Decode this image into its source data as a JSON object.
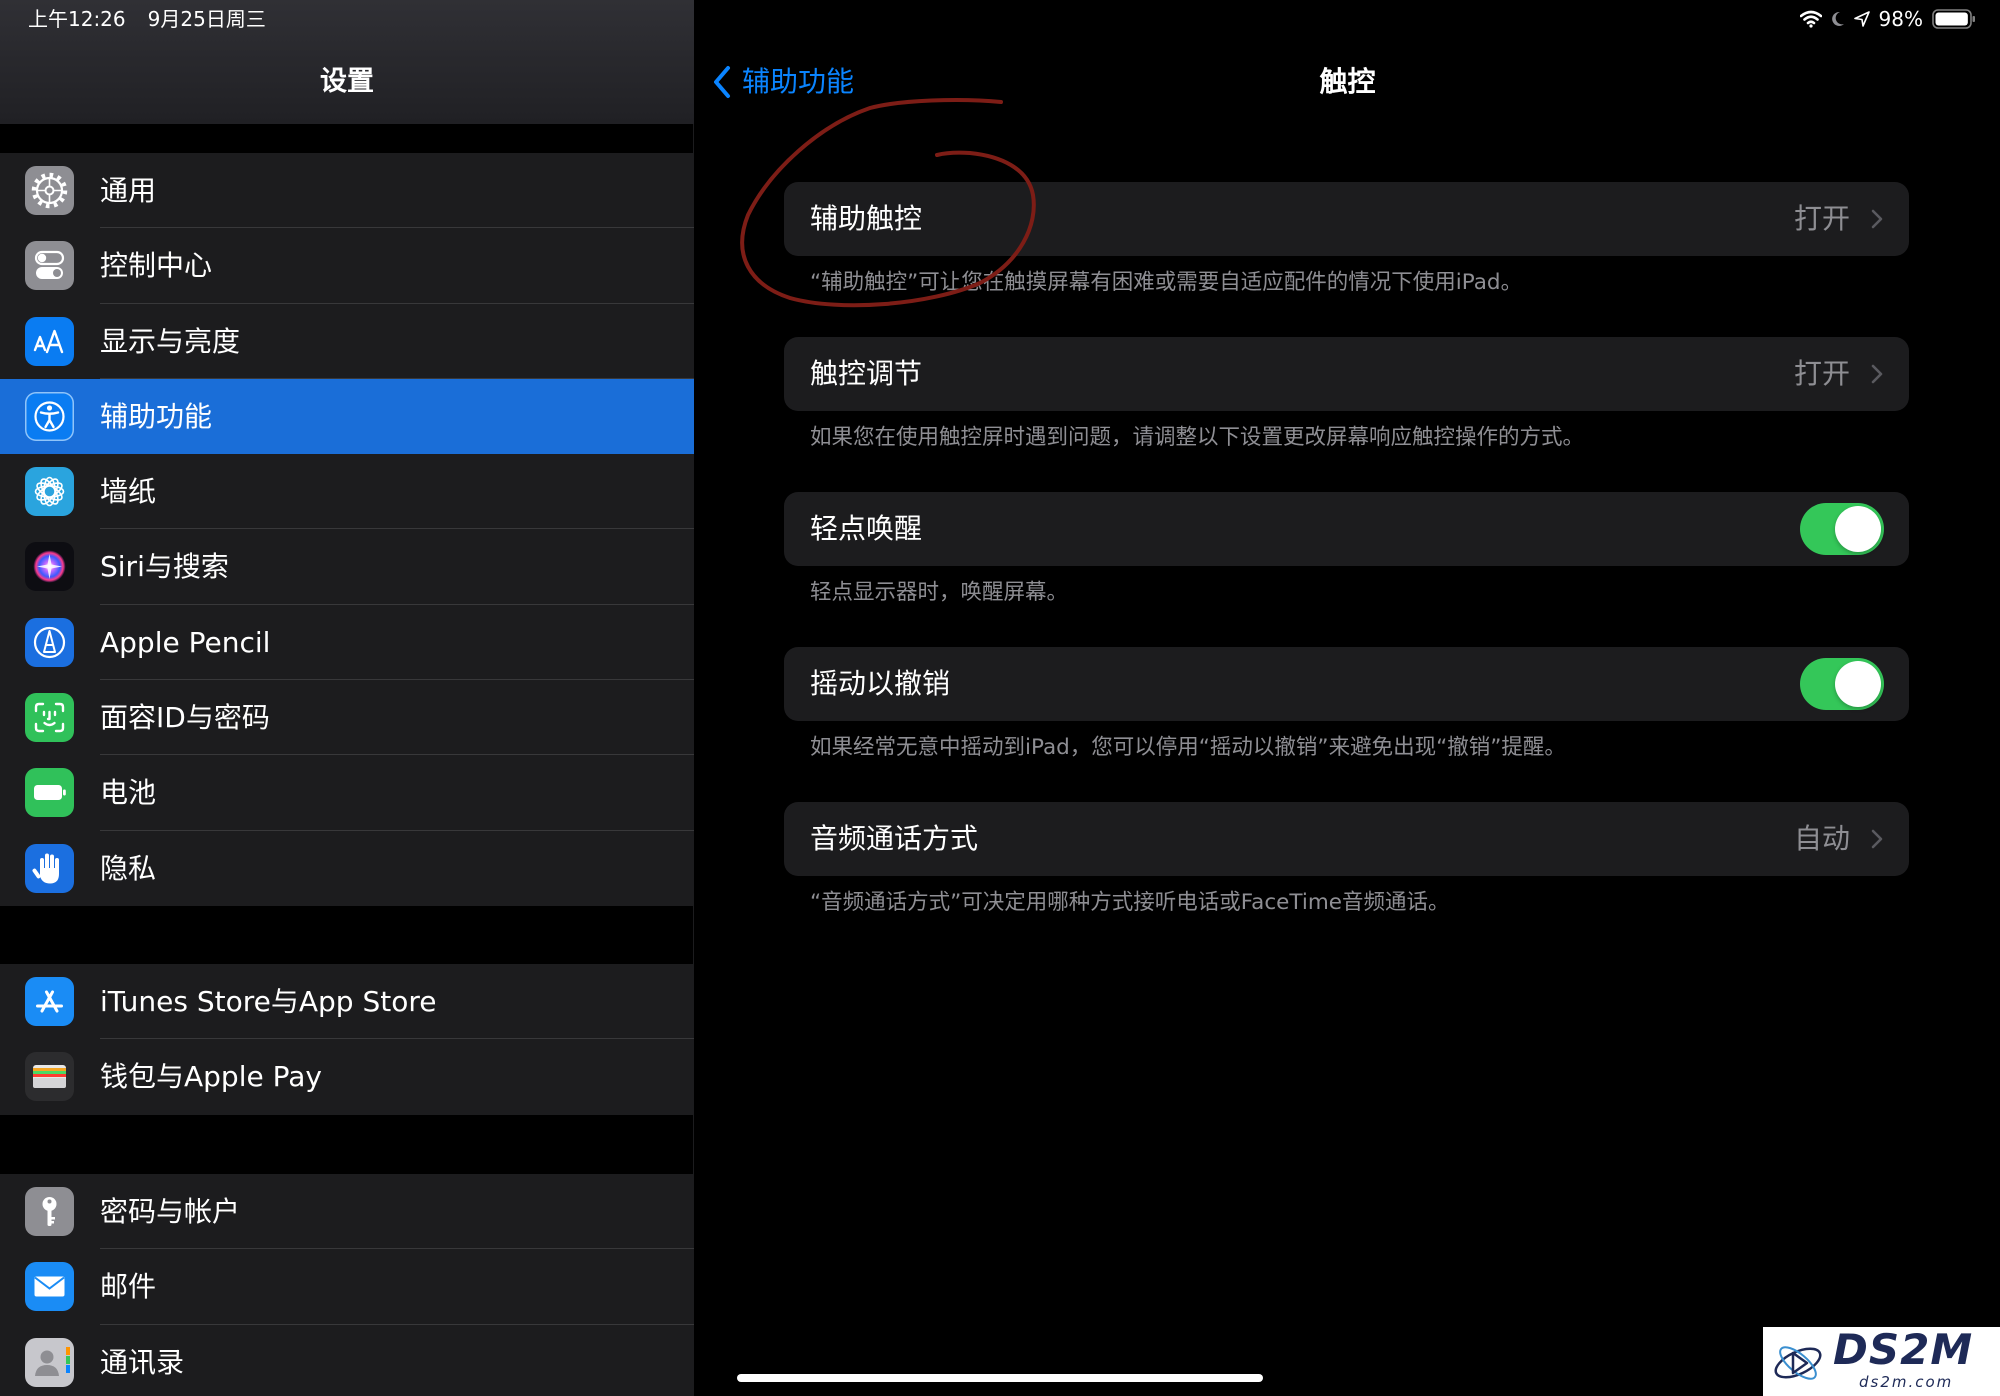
{
  "status_bar": {
    "time": "上午12:26",
    "date": "9月25日周三",
    "battery_percent": "98%",
    "icons": [
      "wifi-icon",
      "moon-icon",
      "location-arrow-icon",
      "battery-icon"
    ]
  },
  "sidebar": {
    "title": "设置",
    "groups": [
      {
        "items": [
          {
            "label": "通用",
            "icon": "gear-icon",
            "icon_bg": "#8e8e93"
          },
          {
            "label": "控制中心",
            "icon": "control-center-icon",
            "icon_bg": "#8e8e93"
          },
          {
            "label": "显示与亮度",
            "icon": "display-brightness-icon",
            "icon_bg": "#0a7cf2"
          },
          {
            "label": "辅助功能",
            "icon": "accessibility-icon",
            "icon_bg": "#0a7cf2",
            "selected": true
          },
          {
            "label": "墙纸",
            "icon": "wallpaper-flower-icon",
            "icon_bg": "#2aa4de"
          },
          {
            "label": "Siri与搜索",
            "icon": "siri-icon",
            "icon_bg": "#0d0d12"
          },
          {
            "label": "Apple Pencil",
            "icon": "apple-pencil-icon",
            "icon_bg": "#1b6fe0"
          },
          {
            "label": "面容ID与密码",
            "icon": "face-id-icon",
            "icon_bg": "#30c15a"
          },
          {
            "label": "电池",
            "icon": "battery-icon",
            "icon_bg": "#30c15a"
          },
          {
            "label": "隐私",
            "icon": "privacy-hand-icon",
            "icon_bg": "#1b6fe0"
          }
        ]
      },
      {
        "items": [
          {
            "label": "iTunes Store与App Store",
            "icon": "app-store-icon",
            "icon_bg": "#1a8cf5"
          },
          {
            "label": "钱包与Apple Pay",
            "icon": "wallet-icon",
            "icon_bg": "#2c2c2e"
          }
        ]
      },
      {
        "items": [
          {
            "label": "密码与帐户",
            "icon": "key-icon",
            "icon_bg": "#8e8e93"
          },
          {
            "label": "邮件",
            "icon": "mail-icon",
            "icon_bg": "#1a8cf5"
          },
          {
            "label": "通讯录",
            "icon": "contacts-icon",
            "icon_bg": "#c7c7cc"
          }
        ]
      }
    ]
  },
  "detail": {
    "back_label": "辅助功能",
    "title": "触控",
    "rows": [
      {
        "title": "辅助触控",
        "value": "打开",
        "control": "disclosure",
        "footer": "“辅助触控”可让您在触摸屏幕有困难或需要自适应配件的情况下使用iPad。"
      },
      {
        "title": "触控调节",
        "value": "打开",
        "control": "disclosure",
        "footer": "如果您在使用触控屏时遇到问题，请调整以下设置更改屏幕响应触控操作的方式。"
      },
      {
        "title": "轻点唤醒",
        "control": "toggle",
        "on": true,
        "footer": "轻点显示器时，唤醒屏幕。"
      },
      {
        "title": "摇动以撤销",
        "control": "toggle",
        "on": true,
        "footer": "如果经常无意中摇动到iPad，您可以停用“摇动以撤销”来避免出现“撤销”提醒。"
      },
      {
        "title": "音频通话方式",
        "value": "自动",
        "control": "disclosure",
        "footer": "“音频通话方式”可决定用哪种方式接听电话或FaceTime音频通话。"
      }
    ]
  },
  "watermark": {
    "logo_text": "DS2M",
    "url_text": "ds2m.com"
  },
  "colors": {
    "accent": "#0a84ff",
    "selection": "#1a6ed8",
    "toggle_on": "#34c759",
    "secondary_text": "#8e8e93",
    "annotation_stroke": "#7d1d16"
  }
}
